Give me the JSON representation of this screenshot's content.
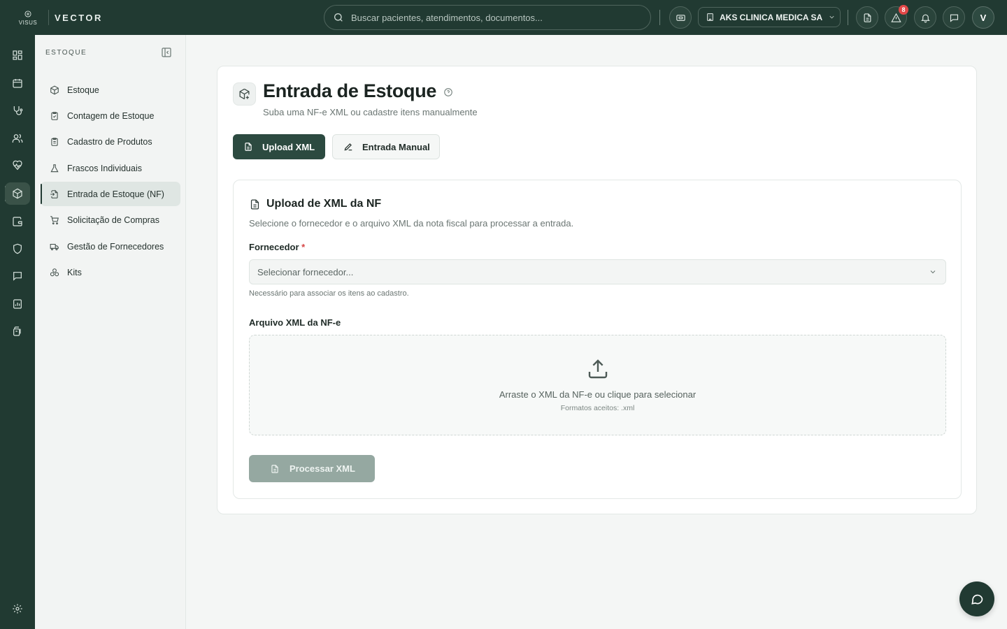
{
  "app": {
    "logo_text": "VISUS",
    "brand": "VECTOR"
  },
  "topbar": {
    "search_placeholder": "Buscar pacientes, atendimentos, documentos...",
    "clinic_name": "AKS CLINICA MEDICA SA",
    "alerts_count": "8",
    "user_initial": "V"
  },
  "rail": {
    "icons": [
      "dashboard-icon",
      "calendar-icon",
      "stethoscope-icon",
      "users-icon",
      "heart-pulse-icon",
      "package-icon",
      "wallet-icon",
      "shield-icon",
      "message-icon",
      "report-icon",
      "files-icon",
      "settings-icon"
    ],
    "active": "package-icon"
  },
  "sidebar": {
    "title": "ESTOQUE",
    "items": [
      {
        "label": "Estoque",
        "icon": "package-icon"
      },
      {
        "label": "Contagem de Estoque",
        "icon": "clipboard-check-icon"
      },
      {
        "label": "Cadastro de Produtos",
        "icon": "clipboard-list-icon"
      },
      {
        "label": "Frascos Individuais",
        "icon": "flask-icon"
      },
      {
        "label": "Entrada de Estoque (NF)",
        "icon": "file-import-icon"
      },
      {
        "label": "Solicitação de Compras",
        "icon": "cart-icon"
      },
      {
        "label": "Gestão de Fornecedores",
        "icon": "truck-icon"
      },
      {
        "label": "Kits",
        "icon": "boxes-icon"
      }
    ],
    "active_index": 4
  },
  "page": {
    "title": "Entrada de Estoque",
    "subtitle": "Suba uma NF-e XML ou cadastre itens manualmente",
    "tabs": {
      "upload_label": "Upload XML",
      "manual_label": "Entrada Manual"
    }
  },
  "upload": {
    "heading": "Upload de XML da NF",
    "description": "Selecione o fornecedor e o arquivo XML da nota fiscal para processar a entrada.",
    "supplier_label": "Fornecedor",
    "required_mark": "*",
    "supplier_placeholder": "Selecionar fornecedor...",
    "supplier_hint": "Necessário para associar os itens ao cadastro.",
    "file_label": "Arquivo XML da NF-e",
    "drop_text": "Arraste o XML da NF-e ou clique para selecionar",
    "drop_formats": "Formatos aceitos: .xml",
    "process_label": "Processar XML"
  },
  "colors": {
    "primary": "#213a32",
    "button_primary": "#2c4a40",
    "button_disabled": "#95a8a1",
    "badge": "#e24848"
  }
}
